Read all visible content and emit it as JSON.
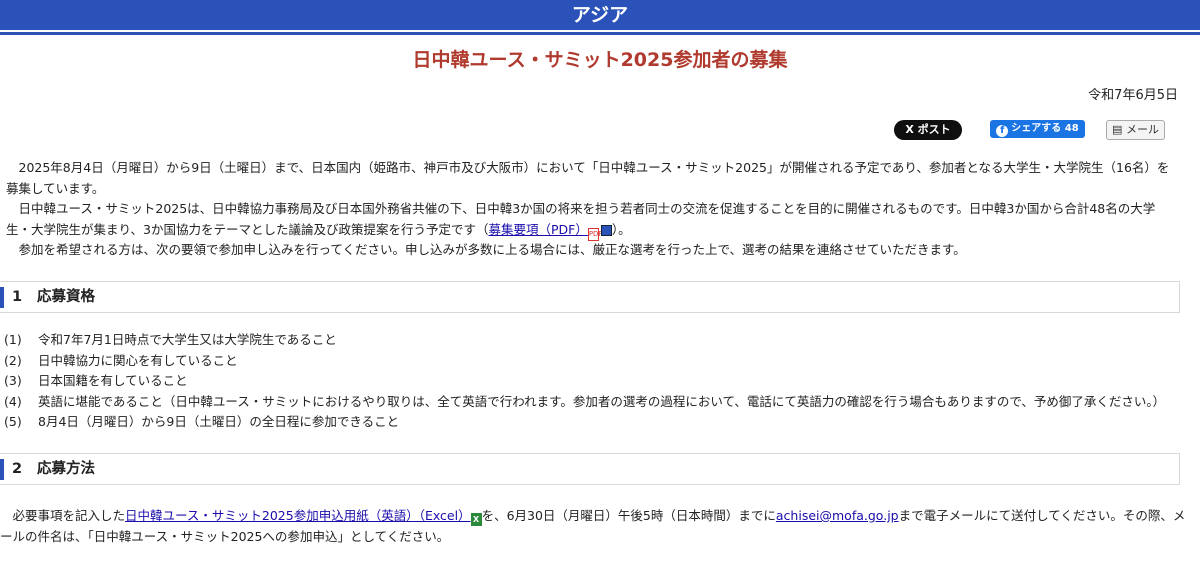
{
  "header": {
    "region": "アジア",
    "title": "日中韓ユース・サミット2025参加者の募集",
    "date": "令和7年6月5日"
  },
  "social": {
    "post_label": "ポスト",
    "x_mark": "X",
    "share_label": "シェアする",
    "share_count": "48",
    "mail_label": "メール"
  },
  "intro": {
    "p1": "　2025年8月4日（月曜日）から9日（土曜日）まで、日本国内（姫路市、神戸市及び大阪市）において「日中韓ユース・サミット2025」が開催される予定であり、参加者となる大学生・大学院生（16名）を募集しています。",
    "p2_before": "　日中韓ユース・サミット2025は、日中韓協力事務局及び日本国外務省共催の下、日中韓3か国の将来を担う若者同士の交流を促進することを目的に開催されるものです。日中韓3か国から合計48名の大学生・大学院生が集まり、3か国協力をテーマとした議論及び政策提案を行う予定です（",
    "p2_link": "募集要項（PDF）",
    "p2_after": "）。",
    "p3": "　参加を希望される方は、次の要領で参加申し込みを行ってください。申し込みが多数に上る場合には、厳正な選考を行った上で、選考の結果を連絡させていただきます。"
  },
  "sections": [
    {
      "number": "1",
      "title": "応募資格",
      "items": [
        {
          "mark": "(1)",
          "text": "令和7年7月1日時点で大学生又は大学院生であること"
        },
        {
          "mark": "(2)",
          "text": "日中韓協力に関心を有していること"
        },
        {
          "mark": "(3)",
          "text": "日本国籍を有していること"
        },
        {
          "mark": "(4)",
          "text": "英語に堪能であること（日中韓ユース・サミットにおけるやり取りは、全て英語で行われます。参加者の選考の過程において、電話にて英語力の確認を行う場合もありますので、予め御了承ください。）"
        },
        {
          "mark": "(5)",
          "text": "8月4日（月曜日）から9日（土曜日）の全日程に参加できること"
        }
      ]
    },
    {
      "number": "2",
      "title": "応募方法",
      "before": "　必要事項を記入した",
      "link": "日中韓ユース・サミット2025参加申込用紙（英語）（Excel）",
      "middle": "を、6月30日（月曜日）午後5時（日本時間）までに",
      "email": "achisei@mofa.go.jp",
      "after": "まで電子メールにて送付してください。その際、メールの件名は、「日中韓ユース・サミット2025への参加申込」としてください。"
    }
  ],
  "icons": {
    "pdf": "pdf-icon",
    "external": "external-window-icon",
    "excel": "excel-icon",
    "mail": "mail-icon",
    "facebook": "facebook-icon"
  },
  "colors": {
    "header_blue": "#2a52b8",
    "title_red": "#b03a2e",
    "link": "#1a0dab"
  }
}
